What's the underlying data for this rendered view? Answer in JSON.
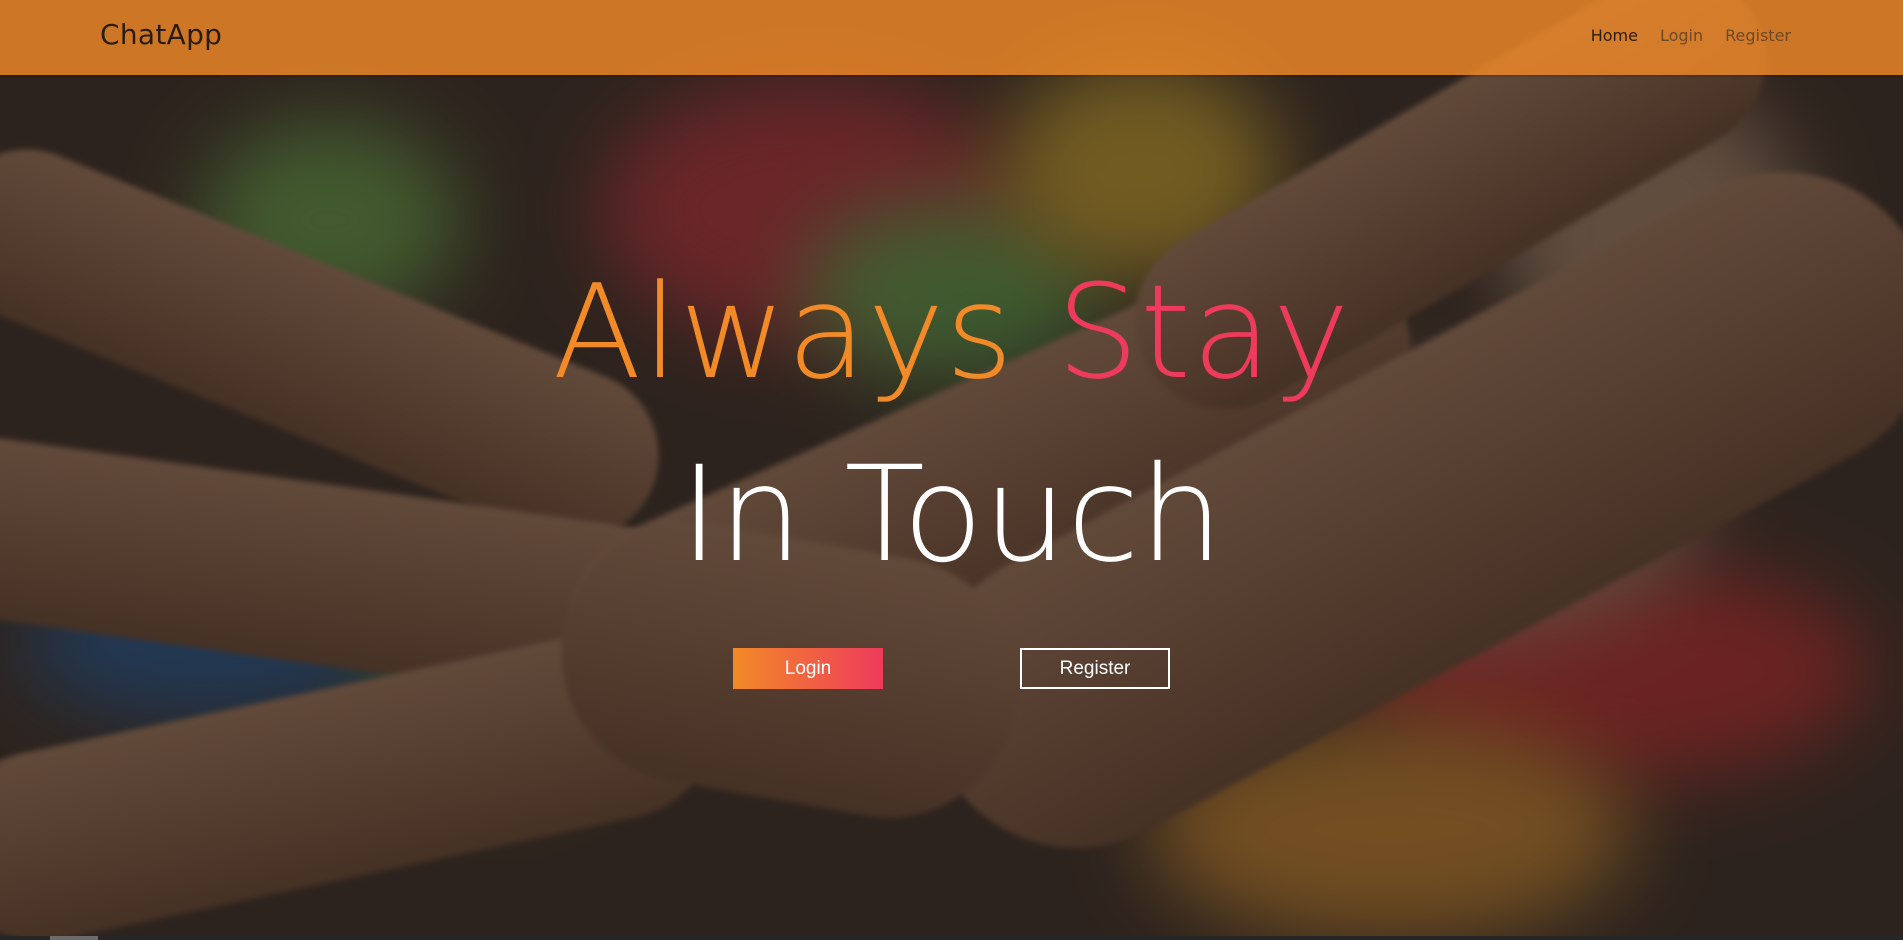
{
  "navbar": {
    "brand": "ChatApp",
    "links": [
      {
        "label": "Home",
        "active": true
      },
      {
        "label": "Login",
        "active": false
      },
      {
        "label": "Register",
        "active": false
      }
    ],
    "background_color": "#f08a28"
  },
  "hero": {
    "headline_word_1": "Always",
    "headline_word_2": "Stay",
    "headline_line_2": "In Touch",
    "buttons": {
      "login_label": "Login",
      "register_label": "Register"
    },
    "background_image": "hands-stacked-together-photo"
  },
  "colors": {
    "accent_orange": "#f28a28",
    "accent_pink": "#ee3a5b",
    "text_white": "#ffffff"
  }
}
